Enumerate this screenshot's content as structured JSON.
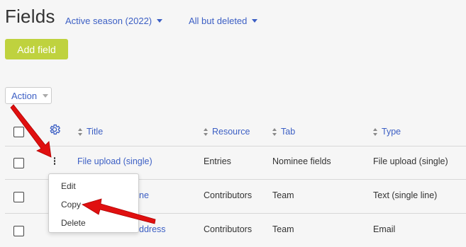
{
  "page": {
    "title": "Fields",
    "season_filter": "Active season (2022)",
    "status_filter": "All but deleted",
    "add_button": "Add field",
    "action_button": "Action"
  },
  "table": {
    "columns": [
      "Title",
      "Resource",
      "Tab",
      "Type"
    ],
    "rows": [
      {
        "title": "File upload (single)",
        "resource": "Entries",
        "tab": "Nominee fields",
        "type": "File upload (single)"
      },
      {
        "title": "ne",
        "resource": "Contributors",
        "tab": "Team",
        "type": "Text (single line)"
      },
      {
        "title": "ddress",
        "resource": "Contributors",
        "tab": "Team",
        "type": "Email"
      }
    ]
  },
  "context_menu": {
    "items": [
      "Edit",
      "Copy",
      "Delete"
    ]
  },
  "colors": {
    "link": "#3c5fc4",
    "add_button": "#bfd23e",
    "arrow": "#e01010"
  },
  "icons": {
    "settings": "gear-icon",
    "row_menu": "kebab-icon",
    "annotation": "red-arrow"
  }
}
